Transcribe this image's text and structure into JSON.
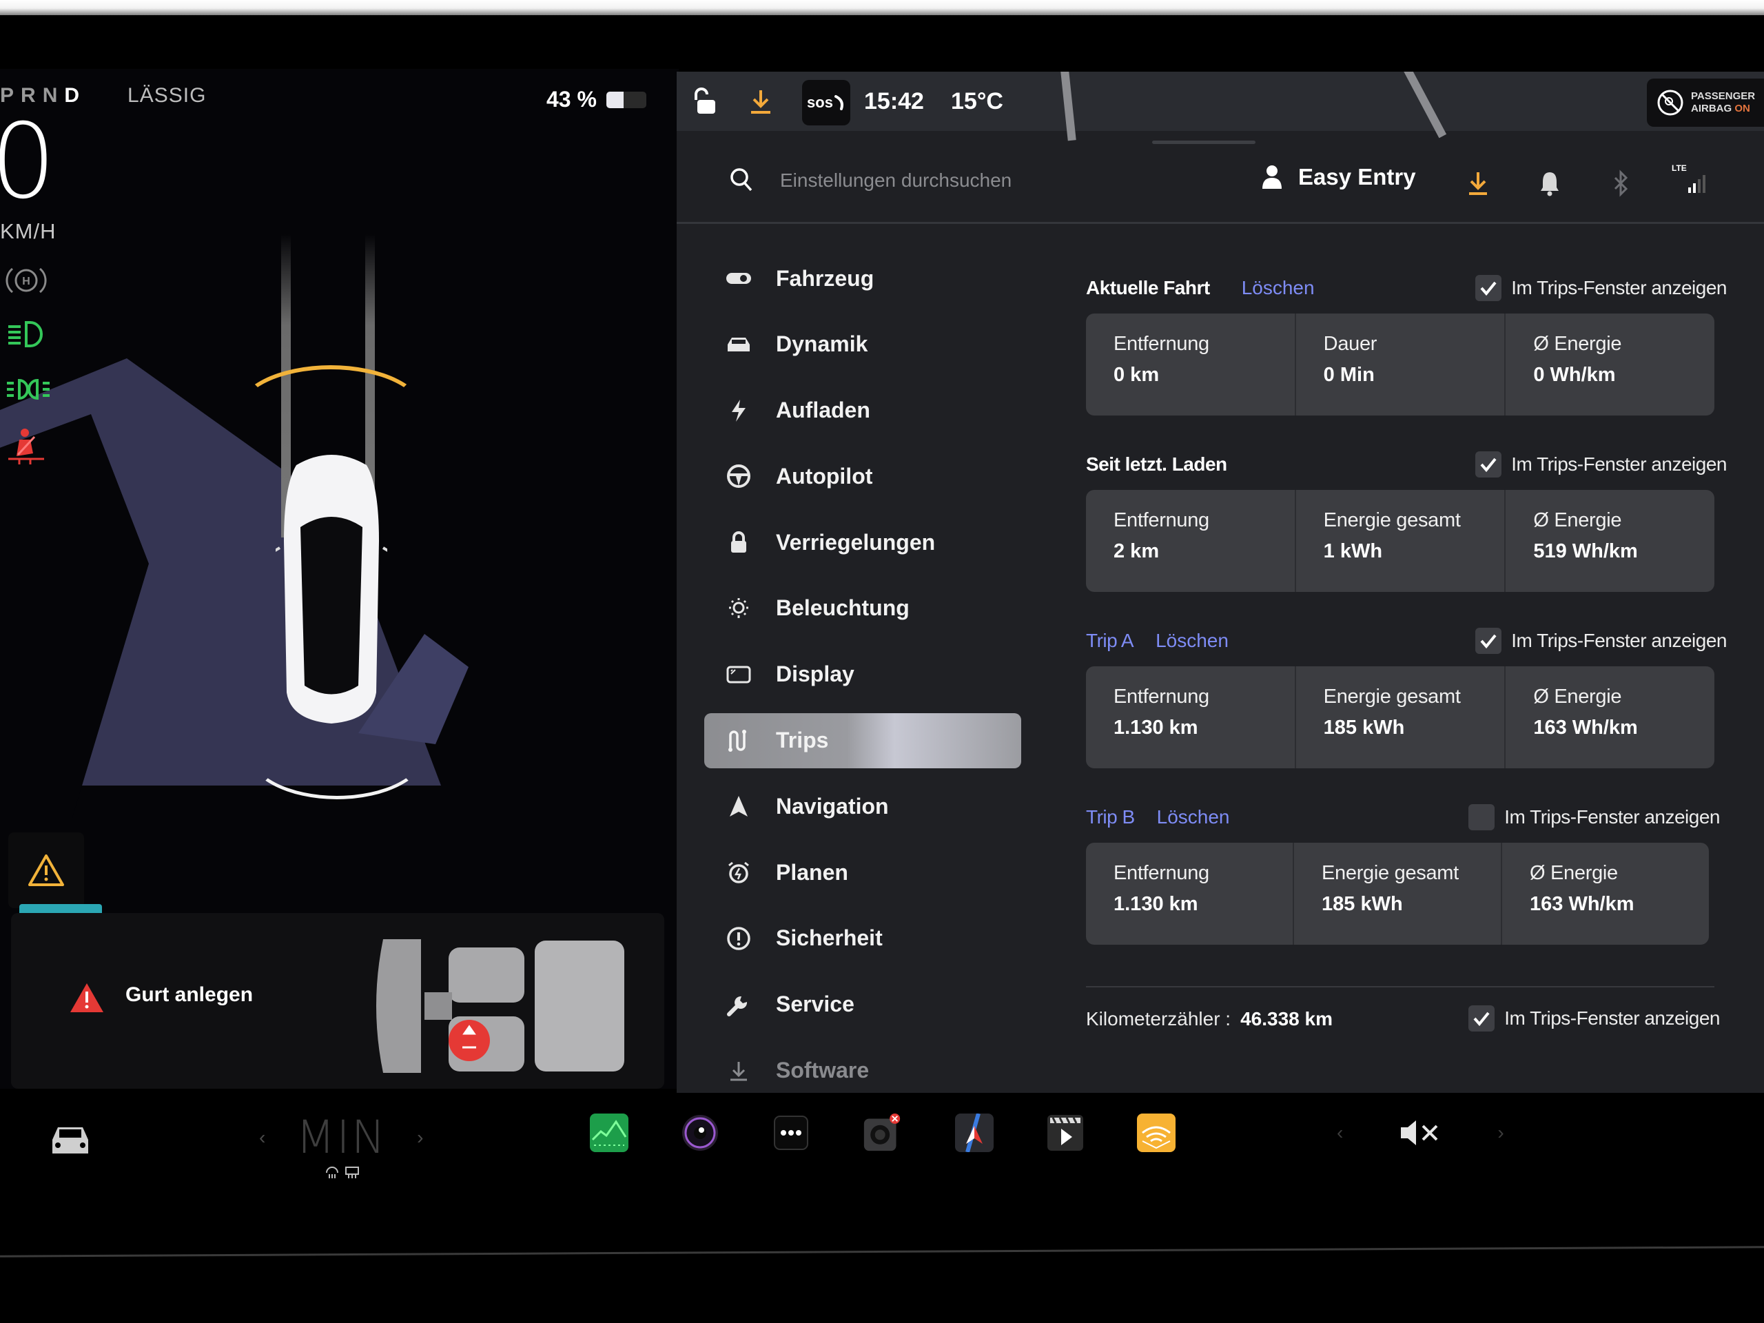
{
  "driver": {
    "gears": [
      "P",
      "R",
      "N",
      "D"
    ],
    "active_gear": "D",
    "drive_mode": "LÄSSIG",
    "speed": "0",
    "speed_unit": "KM/H",
    "battery_percent_label": "43 %",
    "battery_level": 0.43,
    "alert_text": "Gurt anlegen",
    "colors": {
      "lights_green": "#34c759",
      "seatbelt_red": "#e53935",
      "warning_amber": "#f2b33a",
      "front_arc": "#f2b33a"
    }
  },
  "statusbar": {
    "sos_label": "sos",
    "time": "15:42",
    "temperature": "15°C",
    "airbag_line1": "PASSENGER",
    "airbag_line2_prefix": "AIRBAG",
    "airbag_line2_state": "ON"
  },
  "header": {
    "search_placeholder": "Einstellungen durchsuchen",
    "profile_name": "Easy Entry",
    "network": "LTE"
  },
  "sidebar": {
    "items": [
      {
        "label": "Fahrzeug",
        "icon": "toggle-icon"
      },
      {
        "label": "Dynamik",
        "icon": "car-icon"
      },
      {
        "label": "Aufladen",
        "icon": "bolt-icon"
      },
      {
        "label": "Autopilot",
        "icon": "steering-wheel-icon"
      },
      {
        "label": "Verriegelungen",
        "icon": "lock-icon"
      },
      {
        "label": "Beleuchtung",
        "icon": "light-icon"
      },
      {
        "label": "Display",
        "icon": "display-icon"
      },
      {
        "label": "Trips",
        "icon": "trips-icon",
        "active": true
      },
      {
        "label": "Navigation",
        "icon": "navigation-icon"
      },
      {
        "label": "Planen",
        "icon": "alarm-clock-icon"
      },
      {
        "label": "Sicherheit",
        "icon": "alert-circle-icon"
      },
      {
        "label": "Service",
        "icon": "wrench-icon"
      },
      {
        "label": "Software",
        "icon": "download-icon"
      }
    ]
  },
  "trips": {
    "show_in_trips_label": "Im Trips-Fenster anzeigen",
    "clear_label": "Löschen",
    "sections": [
      {
        "title": "Aktuelle Fahrt",
        "clearable": true,
        "title_link": false,
        "checked": true,
        "stats": [
          {
            "label": "Entfernung",
            "value": "0 km"
          },
          {
            "label": "Dauer",
            "value": "0 Min"
          },
          {
            "label": "Ø Energie",
            "value": "0 Wh/km"
          }
        ]
      },
      {
        "title": "Seit letzt. Laden",
        "clearable": false,
        "title_link": false,
        "checked": true,
        "stats": [
          {
            "label": "Entfernung",
            "value": "2 km"
          },
          {
            "label": "Energie gesamt",
            "value": "1 kWh"
          },
          {
            "label": "Ø Energie",
            "value": "519 Wh/km"
          }
        ]
      },
      {
        "title": "Trip A",
        "clearable": true,
        "title_link": true,
        "checked": true,
        "stats": [
          {
            "label": "Entfernung",
            "value": "1.130 km"
          },
          {
            "label": "Energie gesamt",
            "value": "185 kWh"
          },
          {
            "label": "Ø Energie",
            "value": "163 Wh/km"
          }
        ]
      },
      {
        "title": "Trip B",
        "clearable": true,
        "title_link": true,
        "checked": false,
        "stats": [
          {
            "label": "Entfernung",
            "value": "1.130 km"
          },
          {
            "label": "Energie gesamt",
            "value": "185 kWh"
          },
          {
            "label": "Ø Energie",
            "value": "163 Wh/km"
          }
        ]
      }
    ],
    "odometer_label": "Kilometerzähler  :",
    "odometer_value": "46.338 km",
    "odometer_checked": true
  },
  "dock": {
    "climate_value": "MIN",
    "apps": [
      "energy-app",
      "camera-app",
      "more-apps",
      "dashcam-app",
      "navigation-app",
      "media-app",
      "audible-app"
    ],
    "volume_state": "muted"
  },
  "colors": {
    "accent_link": "#7e8cf5",
    "download_orange": "#f3a93b",
    "panel_bg": "#1f2024",
    "card_bg": "#3c3d41"
  }
}
